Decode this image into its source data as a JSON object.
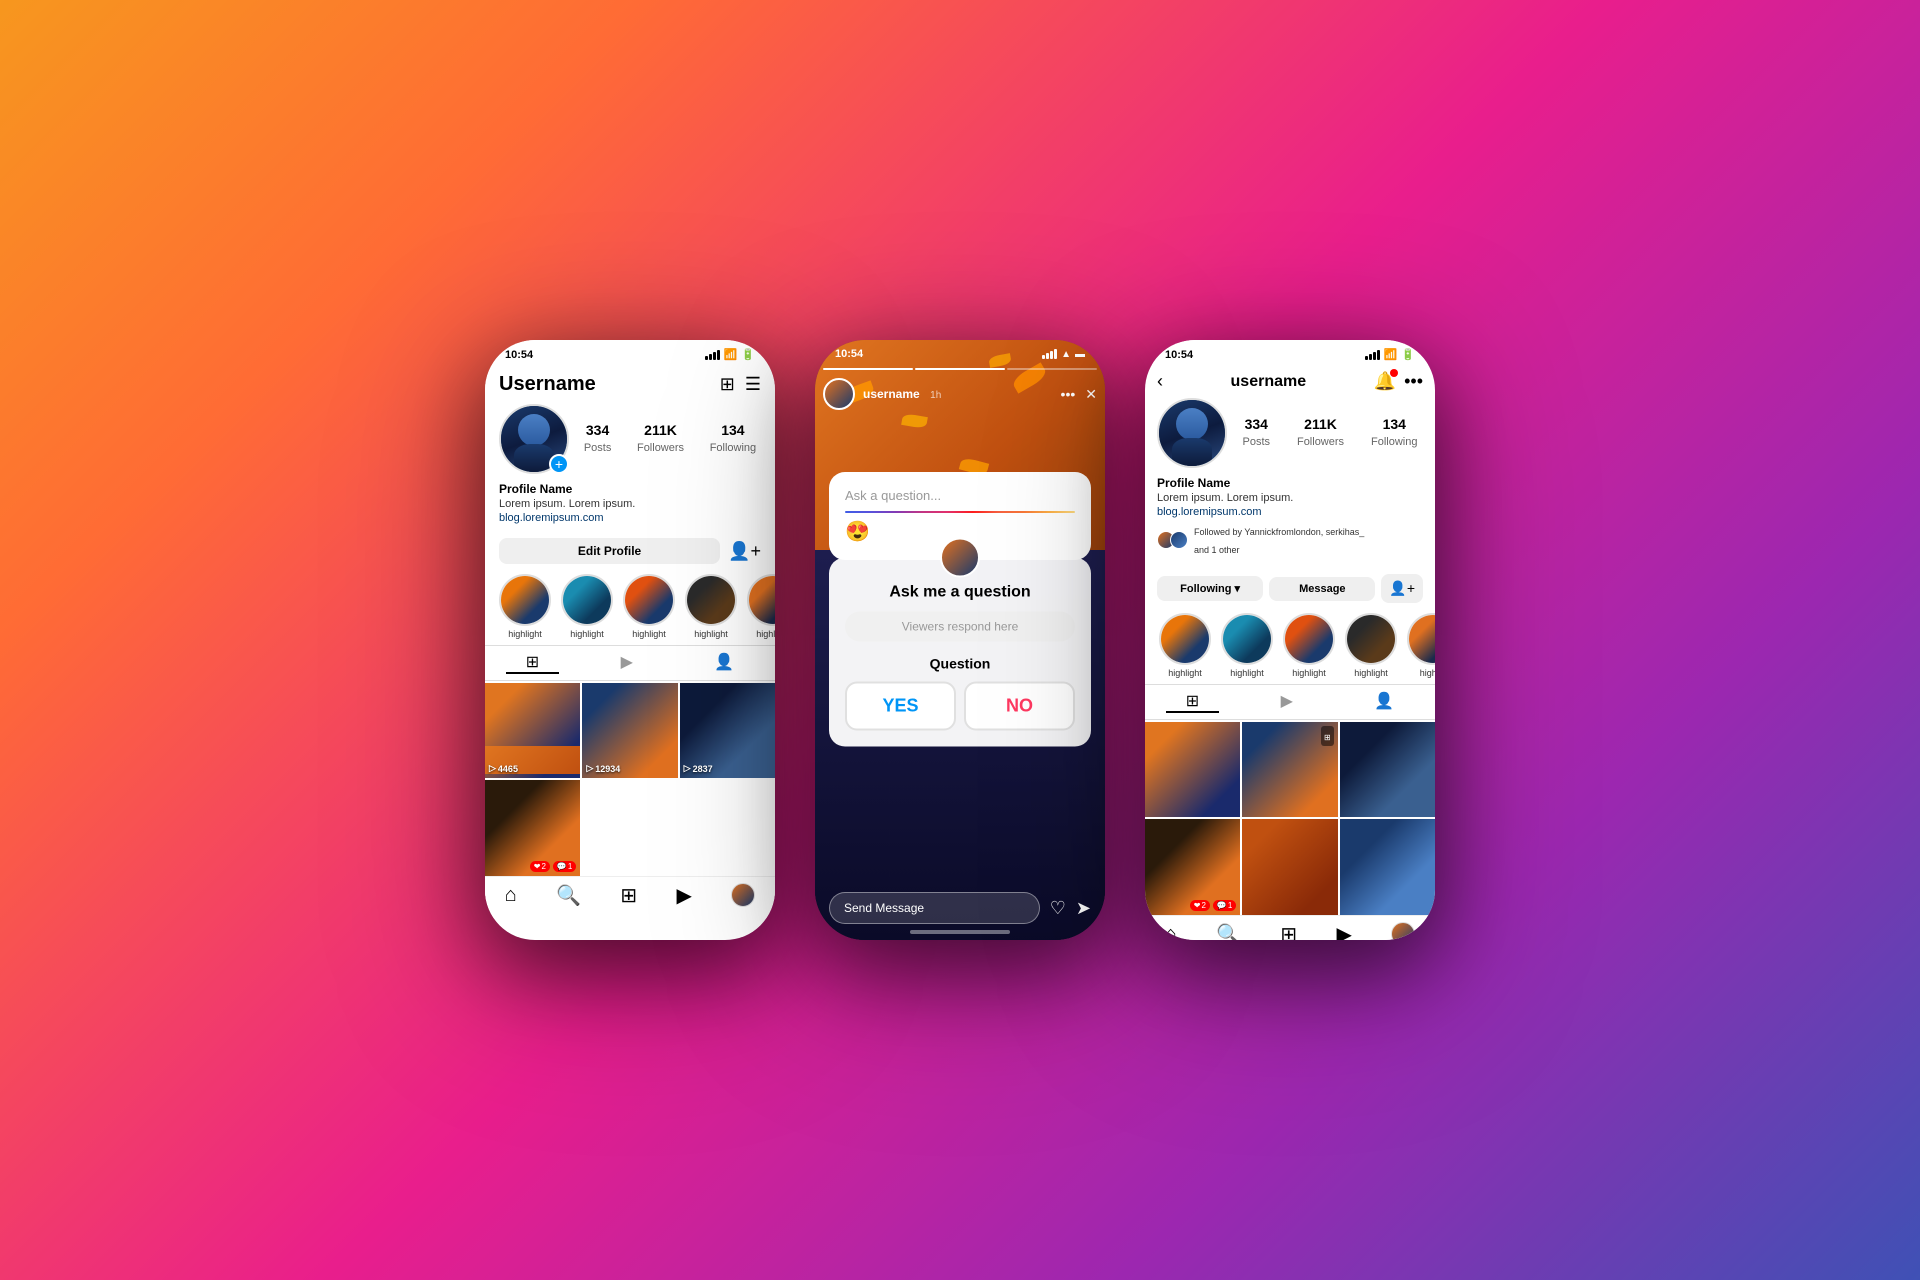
{
  "background": {
    "gradient": "linear-gradient(135deg, #f7971e 0%, #ff6b35 20%, #e91e8c 50%, #9c27b0 75%, #3f51b5 100%)"
  },
  "phone1": {
    "statusBar": {
      "time": "10:54",
      "arrow": "↗"
    },
    "header": {
      "username": "Username",
      "addIcon": "+",
      "menuIcon": "≡"
    },
    "stats": {
      "posts": {
        "number": "334",
        "label": "Posts"
      },
      "followers": {
        "number": "211K",
        "label": "Followers"
      },
      "following": {
        "number": "134",
        "label": "Following"
      }
    },
    "profileName": "Profile Name",
    "bio": "Lorem ipsum. Lorem ipsum.",
    "link": "blog.loremipsum.com",
    "editButton": "Edit Profile",
    "highlights": [
      "highlight",
      "highlight",
      "highlight",
      "highlight",
      "highlight"
    ],
    "grid": {
      "views": [
        "4465",
        "12934",
        "2837"
      ]
    },
    "badges": {
      "hearts": "2",
      "comments": "1"
    }
  },
  "phone2": {
    "statusBar": {
      "time": "10:54",
      "arrow": "↗"
    },
    "story": {
      "username": "username",
      "timeAgo": "1h",
      "questionPlaceholder": "Ask a question...",
      "askTitle": "Ask me a question",
      "viewersPlaceholder": "Viewers respond here",
      "questionLabel": "Question",
      "yes": "YES",
      "no": "NO",
      "sendPlaceholder": "Send Message"
    }
  },
  "phone3": {
    "statusBar": {
      "time": "10:54",
      "arrow": "↗"
    },
    "username": "username",
    "stats": {
      "posts": {
        "number": "334",
        "label": "Posts"
      },
      "followers": {
        "number": "211K",
        "label": "Followers"
      },
      "following": {
        "number": "134",
        "label": "Following"
      }
    },
    "profileName": "Profile Name",
    "bio": "Lorem ipsum. Lorem ipsum.",
    "link": "blog.loremipsum.com",
    "followedBy": "Followed by Yannickfromlondon, serkihas_",
    "followedByExtra": "and 1 other",
    "followingBtn": "Following",
    "messageBtn": "Message",
    "highlights": [
      "highlight",
      "highlight",
      "highlight",
      "highlight",
      "highl..."
    ],
    "badges": {
      "hearts": "2",
      "comments": "1"
    }
  }
}
